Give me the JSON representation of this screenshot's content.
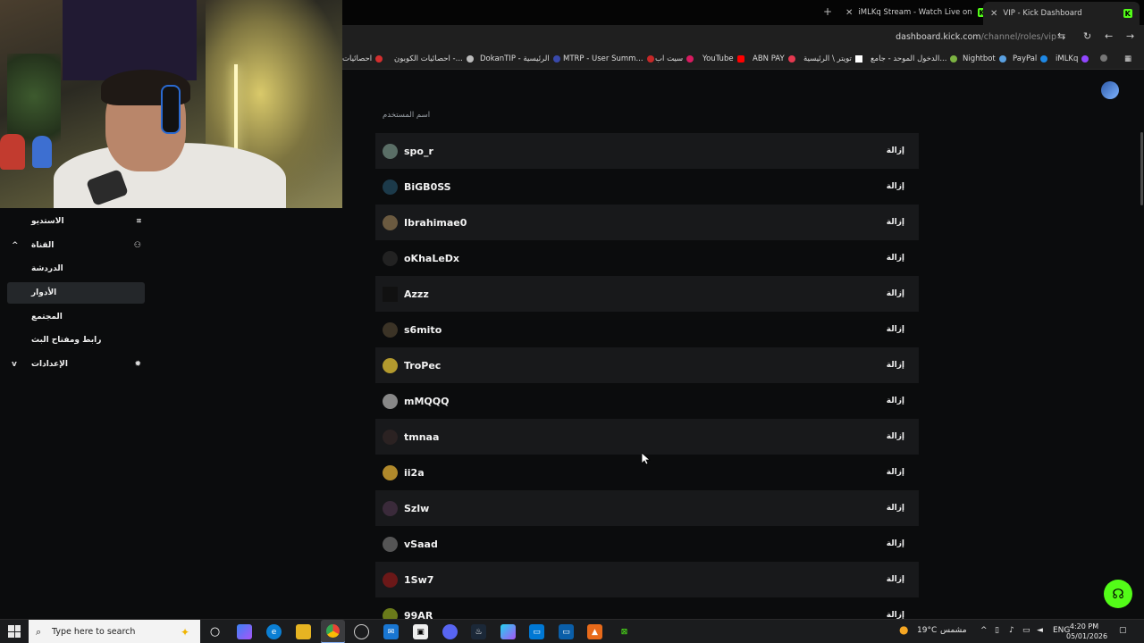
{
  "browser": {
    "tabs": [
      {
        "label": "iMLKq Stream - Watch Live on",
        "active": false
      },
      {
        "label": "VIP - Kick Dashboard",
        "active": true
      }
    ],
    "url_host": "dashboard.kick.com",
    "url_path": "/channel/roles/vip",
    "bookmarks": [
      "iMLKq",
      "PayPal",
      "Nightbot",
      "الدخول الموحد - جامع...",
      "تويتر \\ الرئيسية",
      "ABN PAY",
      "YouTube",
      "سيت اب",
      "MTRP - User Summ...",
      "DokanTIP - الرئيسية",
      "احصائيات الكوبون -...",
      "احصائيات"
    ]
  },
  "sidebar": {
    "items": [
      {
        "label": "الاستديو"
      },
      {
        "label": "القناة"
      },
      {
        "label": "الدردشة"
      },
      {
        "label": "الأدوار"
      },
      {
        "label": "المجتمع"
      },
      {
        "label": "رابط ومفتاح البث"
      },
      {
        "label": "الإعدادات"
      }
    ]
  },
  "vip_list": {
    "column_header": "اسم المستخدم",
    "remove_label": "إزالة",
    "users": [
      {
        "name": "spo_r"
      },
      {
        "name": "BiGB0SS"
      },
      {
        "name": "Ibrahimae0"
      },
      {
        "name": "oKhaLeDx"
      },
      {
        "name": "Azzz"
      },
      {
        "name": "s6mito"
      },
      {
        "name": "TroPec"
      },
      {
        "name": "mMQQQ"
      },
      {
        "name": "tmnaa"
      },
      {
        "name": "ii2a"
      },
      {
        "name": "Szlw"
      },
      {
        "name": "vSaad"
      },
      {
        "name": "1Sw7"
      },
      {
        "name": "99AR"
      }
    ]
  },
  "taskbar": {
    "search_placeholder": "Type here to search",
    "weather": "19°C",
    "weather_desc": "مشمس",
    "language": "ENG",
    "time": "4:20 PM",
    "date": "05/01/2026"
  },
  "colors": {
    "accent": "#53fc18",
    "row_alt": "#18191b",
    "background": "#0b0c0d"
  }
}
